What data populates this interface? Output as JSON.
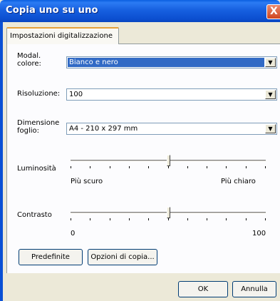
{
  "window": {
    "title": "Copia uno su uno",
    "close_symbol": "X"
  },
  "tab": {
    "label": "Impostazioni digitalizzazione"
  },
  "color_mode": {
    "label_line1": "Modal.",
    "label_line2": "colore:",
    "value": "Bianco e nero"
  },
  "resolution": {
    "label": "Risoluzione:",
    "value": "100"
  },
  "paper_size": {
    "label_line1": "Dimensione",
    "label_line2": "foglio:",
    "value": "A4 - 210 x 297 mm"
  },
  "brightness": {
    "label": "Luminosità",
    "min_label": "Più scuro",
    "max_label": "Più chiaro",
    "level": 0.5
  },
  "contrast": {
    "label": "Contrasto",
    "min_label": "0",
    "max_label": "100",
    "level": 0.5
  },
  "buttons": {
    "defaults": "Predefinite",
    "copy_options": "Opzioni di copia...",
    "ok": "OK",
    "cancel": "Annulla"
  },
  "icons": {
    "dropdown": "▼"
  }
}
